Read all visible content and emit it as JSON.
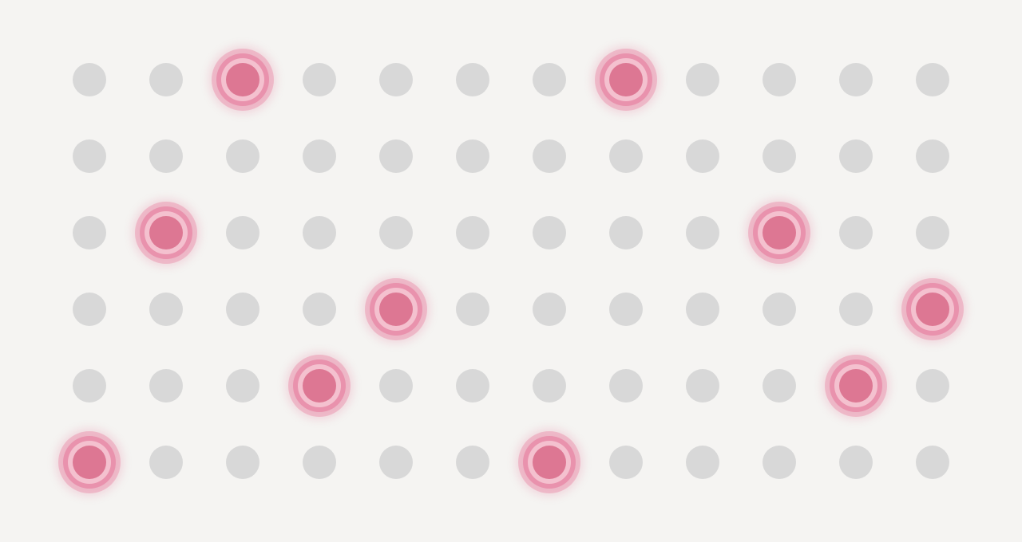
{
  "colors": {
    "background": "#f5f4f2",
    "inactive": "#d8d8d8",
    "active": "#dd7793",
    "glow": "#e88ca8"
  },
  "grid": {
    "rows": 6,
    "columns": 12,
    "active_cells": [
      [
        0,
        2
      ],
      [
        0,
        7
      ],
      [
        2,
        1
      ],
      [
        2,
        9
      ],
      [
        3,
        4
      ],
      [
        3,
        11
      ],
      [
        4,
        3
      ],
      [
        4,
        10
      ],
      [
        5,
        0
      ],
      [
        5,
        6
      ]
    ]
  }
}
